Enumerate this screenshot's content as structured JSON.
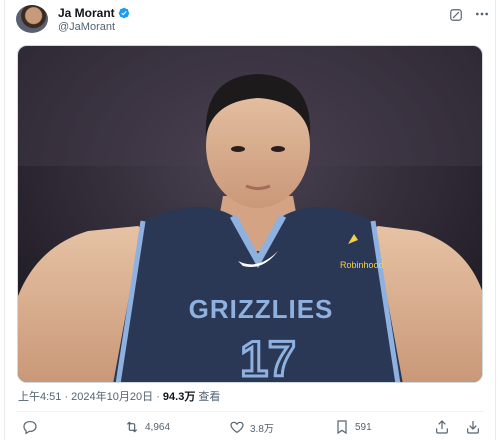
{
  "tweet": {
    "author_name": "Ja Morant",
    "handle": "@JaMorant",
    "verified_icon": "verified-badge-icon",
    "accent_color": "#1d9bf0",
    "image": {
      "jersey_brand": "GRIZZLIES",
      "jersey_number": "17",
      "sponsor_logo_text": "Robinhood"
    },
    "timestamp": "上午4:51 · 2024年10月20日",
    "separator": " · ",
    "views_count": "94.3万",
    "views_label": " 查看",
    "actions": {
      "reply": {
        "icon": "reply-icon",
        "count": ""
      },
      "retweet": {
        "icon": "retweet-icon",
        "count": "4,964"
      },
      "like": {
        "icon": "heart-icon",
        "count": "3.8万"
      },
      "bookmark": {
        "icon": "bookmark-icon",
        "count": "591"
      },
      "share": {
        "icon": "share-icon",
        "count": ""
      },
      "download": {
        "icon": "download-icon",
        "count": ""
      }
    }
  }
}
